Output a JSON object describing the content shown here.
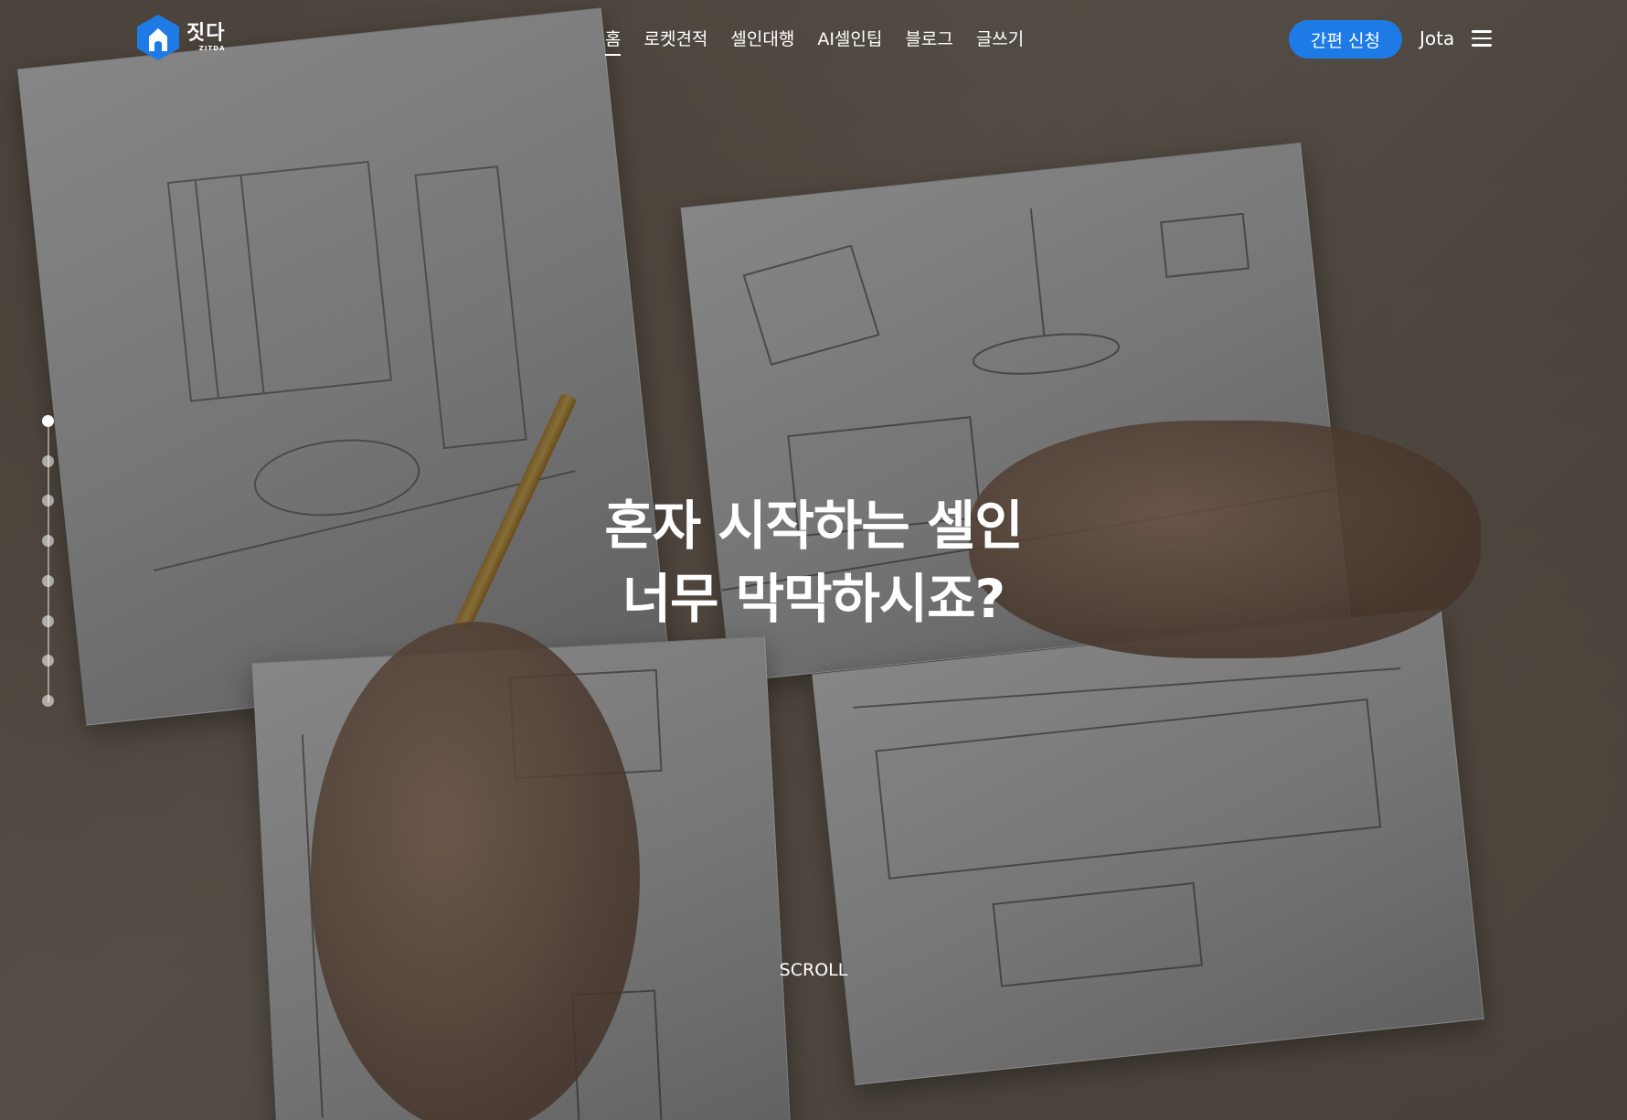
{
  "brand": {
    "name_ko": "짓다",
    "name_en": "ZITDA",
    "accent_color": "#1e7be6"
  },
  "nav": {
    "items": [
      {
        "label": "홈",
        "active": true
      },
      {
        "label": "로켓견적",
        "active": false
      },
      {
        "label": "셀인대행",
        "active": false
      },
      {
        "label": "AI셀인팁",
        "active": false
      },
      {
        "label": "블로그",
        "active": false
      },
      {
        "label": "글쓰기",
        "active": false
      }
    ]
  },
  "header": {
    "cta_label": "간편 신청",
    "user_name": "Jota",
    "menu_icon": "hamburger-menu-icon"
  },
  "hero": {
    "line1": "혼자 시작하는 셀인",
    "line2": "너무 막막하시죠?",
    "scroll_label": "SCROLL"
  },
  "slides": {
    "count": 8,
    "active_index": 0
  }
}
